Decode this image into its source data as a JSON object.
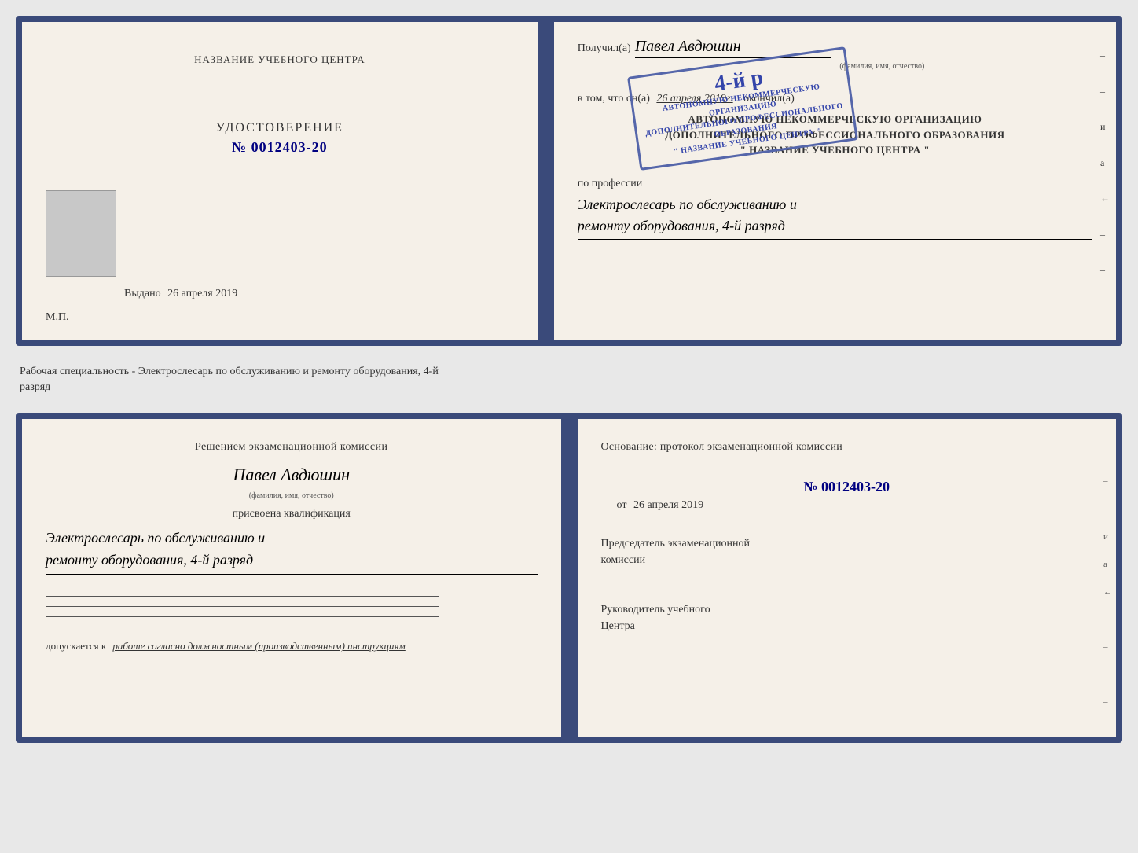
{
  "page": {
    "background": "#e8e8e8"
  },
  "top_booklet": {
    "left": {
      "title": "НАЗВАНИЕ УЧЕБНОГО ЦЕНТРА",
      "cert_label": "УДОСТОВЕРЕНИЕ",
      "cert_number": "№ 0012403-20",
      "issued_prefix": "Выдано",
      "issued_date": "26 апреля 2019",
      "mp_label": "М.П."
    },
    "right": {
      "received_label": "Получил(а)",
      "received_name": "Павел Авдюшин",
      "fio_label": "(фамилия, имя, отчество)",
      "completion_text": "в том, что он(а)",
      "completion_date": "26 апреля 2019г.",
      "finished_label": "окончил(а)",
      "org_line1": "АВТОНОМНУЮ НЕКОММЕРЧЕСКУЮ ОРГАНИЗАЦИЮ",
      "org_line2": "ДОПОЛНИТЕЛЬНОГО ПРОФЕССИОНАЛЬНОГО ОБРАЗОВАНИЯ",
      "org_line3": "\" НАЗВАНИЕ УЧЕБНОГО ЦЕНТРА \"",
      "profession_prefix": "по профессии",
      "profession_value_line1": "Электрослесарь по обслуживанию и",
      "profession_value_line2": "ремонту оборудования, 4-й разряд"
    },
    "stamp": {
      "big_text": "4-й р",
      "line1": "АВТОНОМНУЮ НЕКОММЕРЧЕСКУЮ ОРГАНИЗАЦИЮ",
      "line2": "ДОПОЛНИТЕЛЬНОГО ПРОФЕССИОНАЛЬНОГО ОБРАЗОВАНИЯ",
      "line3": "\" НАЗВАНИЕ УЧЕБНОГО ЦЕНТРА \""
    }
  },
  "middle_text": {
    "line1": "Рабочая специальность - Электрослесарь по обслуживанию и ремонту оборудования, 4-й",
    "line2": "разряд"
  },
  "bottom_booklet": {
    "left": {
      "decision_text": "Решением экзаменационной комиссии",
      "person_name": "Павел Авдюшин",
      "fio_label": "(фамилия, имя, отчество)",
      "qualification_label": "присвоена квалификация",
      "qualification_line1": "Электрослесарь по обслуживанию и",
      "qualification_line2": "ремонту оборудования, 4-й разряд",
      "allowed_prefix": "допускается к",
      "allowed_text": "работе согласно должностным (производственным) инструкциям"
    },
    "right": {
      "basis_label": "Основание: протокол экзаменационной комиссии",
      "basis_number": "№ 0012403-20",
      "basis_date_prefix": "от",
      "basis_date": "26 апреля 2019",
      "chairman_label_line1": "Председатель экзаменационной",
      "chairman_label_line2": "комиссии",
      "head_label_line1": "Руководитель учебного",
      "head_label_line2": "Центра"
    },
    "side_marks": [
      "-",
      "-",
      "-",
      "и",
      "а",
      "←",
      "-",
      "-",
      "-",
      "-"
    ]
  }
}
